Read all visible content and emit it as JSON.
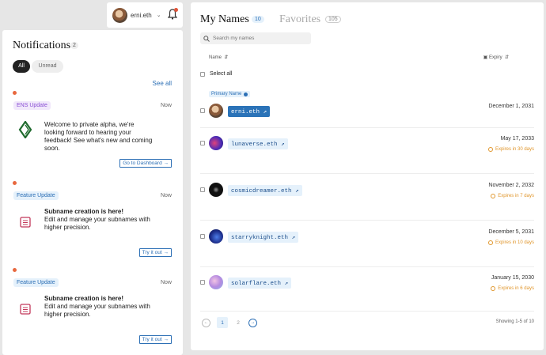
{
  "user": {
    "name": "erni.eth",
    "avatar_icon": "user-avatar"
  },
  "notifications": {
    "title": "Notifications",
    "count": "2",
    "filters": {
      "all": "All",
      "unread": "Unread"
    },
    "see_all": "See all",
    "items": [
      {
        "tag": "ENS Update",
        "time": "Now",
        "icon": "ens-logo-icon",
        "title": "",
        "text": "Welcome to private alpha, we're looking forward to hearing your feedback! See what's new and coming soon.",
        "cta": "Go to Dashboard →"
      },
      {
        "tag": "Feature Update",
        "time": "Now",
        "icon": "list-icon",
        "title": "Subname creation is here!",
        "text": "Edit and manage your subnames with higher precision.",
        "cta": "Try it out →"
      },
      {
        "tag": "Feature Update",
        "time": "Now",
        "icon": "list-icon",
        "title": "Subname creation is here!",
        "text": "Edit and manage your subnames with higher precision.",
        "cta": "Try it out →"
      }
    ]
  },
  "names": {
    "tab_my": "My Names",
    "tab_my_count": "10",
    "tab_fav": "Favorites",
    "tab_fav_count": "105",
    "search_placeholder": "Search my names",
    "col_name": "Name",
    "col_expiry": "Expiry",
    "select_all": "Select all",
    "primary_label": "Primary Name",
    "rows": [
      {
        "name": "erni.eth",
        "date": "December 1, 2031",
        "expires": "",
        "primary": true
      },
      {
        "name": "lunaverse.eth",
        "date": "May 17, 2033",
        "expires": "Expires in 30 days",
        "primary": false
      },
      {
        "name": "cosmicdreamer.eth",
        "date": "November 2, 2032",
        "expires": "Expires in 7 days",
        "primary": false
      },
      {
        "name": "starryknight.eth",
        "date": "December 5, 2031",
        "expires": "Expires in 10 days",
        "primary": false
      },
      {
        "name": "solarflare.eth",
        "date": "January 15, 2030",
        "expires": "Expires in 6 days",
        "primary": false
      }
    ],
    "pagination": {
      "page1": "1",
      "page2": "2",
      "showing": "Showing 1-5 of 10"
    }
  },
  "colors": {
    "accent": "#2c6fb5",
    "warning": "#e0962c",
    "dot": "#e8683e"
  }
}
